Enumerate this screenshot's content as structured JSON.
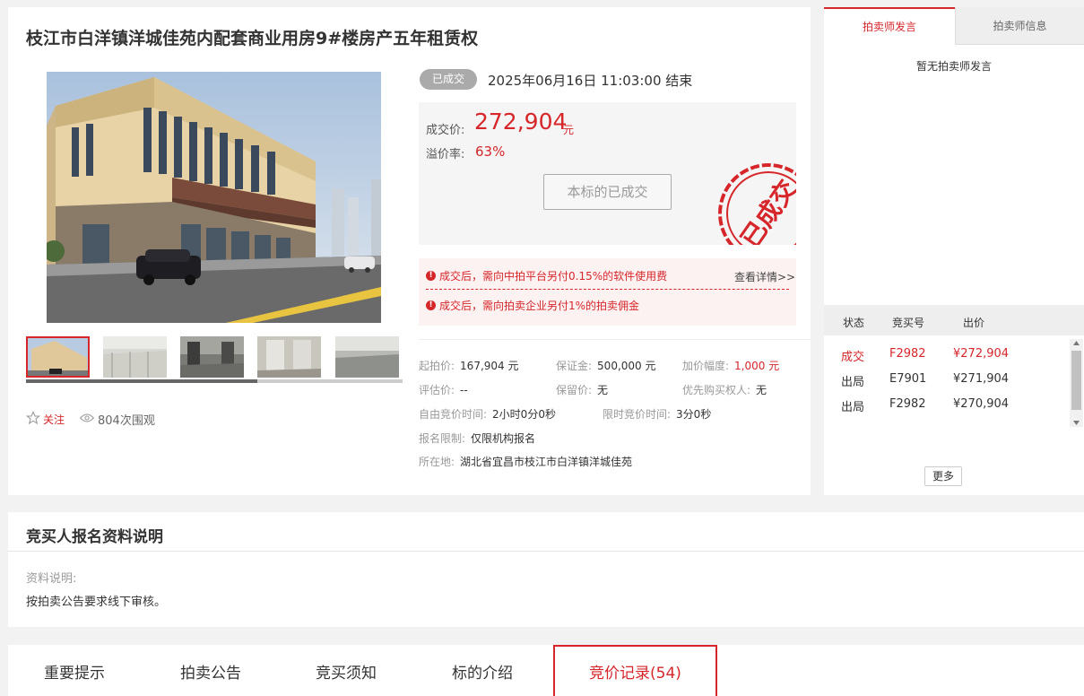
{
  "lot": {
    "title": "枝江市白洋镇洋城佳苑内配套商业用房9#楼房产五年租赁权"
  },
  "gallery": {
    "thumbnails": [
      "thumb-1",
      "thumb-2",
      "thumb-3",
      "thumb-4",
      "thumb-5"
    ],
    "active_index": 0
  },
  "social": {
    "follow_label": "关注",
    "views_label": "804次围观"
  },
  "status": {
    "badge": "已成交",
    "end_time": "2025年06月16日  11:03:00 结束"
  },
  "price": {
    "deal_label": "成交价:",
    "deal_price": "272,904",
    "deal_unit": "元",
    "premium_label": "溢价率:",
    "premium_value": "63%",
    "done_button": "本标的已成交",
    "stamp_text": "已成交"
  },
  "notices": {
    "items": [
      "成交后，需向中拍平台另付0.15%的软件使用费",
      "成交后，需向拍卖企业另付1%的拍卖佣金"
    ],
    "detail_link": "查看详情>>"
  },
  "info": {
    "start_price_label": "起拍价:",
    "start_price": "167,904 元",
    "deposit_label": "保证金:",
    "deposit": "500,000 元",
    "increment_label": "加价幅度:",
    "increment": "1,000 元",
    "appraisal_label": "评估价:",
    "appraisal": "--",
    "reserve_label": "保留价:",
    "reserve": "无",
    "priority_label": "优先购买权人:",
    "priority": "无",
    "free_time_label": "自由竞价时间:",
    "free_time": "2小时0分0秒",
    "limit_time_label": "限时竞价时间:",
    "limit_time": "3分0秒",
    "restriction_label": "报名限制:",
    "restriction": "仅限机构报名",
    "location_label": "所在地:",
    "location": "湖北省宜昌市枝江市白洋镇洋城佳苑"
  },
  "right_panel": {
    "tab_speech": "拍卖师发言",
    "tab_info": "拍卖师信息",
    "no_speech": "暂无拍卖师发言",
    "columns": [
      "状态",
      "竞买号",
      "出价"
    ],
    "bids": [
      {
        "status": "成交",
        "bidder": "F2982",
        "price": "¥272,904"
      },
      {
        "status": "出局",
        "bidder": "E7901",
        "price": "¥271,904"
      },
      {
        "status": "出局",
        "bidder": "F2982",
        "price": "¥270,904"
      }
    ],
    "more_button": "更多"
  },
  "docs": {
    "title": "竞买人报名资料说明",
    "label": "资料说明:",
    "text": "按拍卖公告要求线下审核。"
  },
  "bottom_tabs": {
    "notice": "重要提示",
    "announcement": "拍卖公告",
    "instructions": "竞买须知",
    "introduction": "标的介绍",
    "bid_records": "竞价记录(54)"
  },
  "colors": {
    "accent": "#d6262a",
    "badge_gray": "#aaaaaa"
  }
}
